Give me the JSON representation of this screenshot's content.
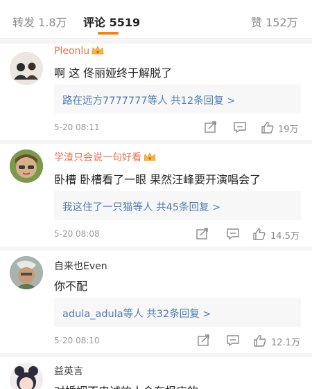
{
  "tabs": {
    "repost": "转发 1.8万",
    "comment_label": "评论",
    "comment_count": "5519",
    "like": "赞 152万"
  },
  "colors": {
    "accent": "#ff8200",
    "username_vip": "#eb7350",
    "link": "#4d7eb3"
  },
  "comments": [
    {
      "user": "Pleonlu",
      "vip": true,
      "text": "啊 这 佟丽娅终于解脱了",
      "reply_users": "路在远方7777777",
      "reply_mid": "等人",
      "reply_total": "共12条回复 >",
      "time": "5-20 08:11",
      "likes": "19万"
    },
    {
      "user": "学渣只会说一句好看",
      "vip": true,
      "text": "卧槽 卧槽看了一眼 果然汪峰要开演唱会了",
      "reply_users": "我这住了一只猫",
      "reply_mid": "等人",
      "reply_total": "共45条回复 >",
      "time": "5-20 08:08",
      "likes": "14.5万"
    },
    {
      "user": "自来也Even",
      "vip": false,
      "text": "你不配",
      "reply_users": "adula_adula",
      "reply_mid": "等人",
      "reply_total": "共32条回复 >",
      "time": "5-20 08:10",
      "likes": "12.1万"
    },
    {
      "user": "益英言",
      "vip": false,
      "text": "对婚姻不忠诚的人会有报应的"
    }
  ]
}
